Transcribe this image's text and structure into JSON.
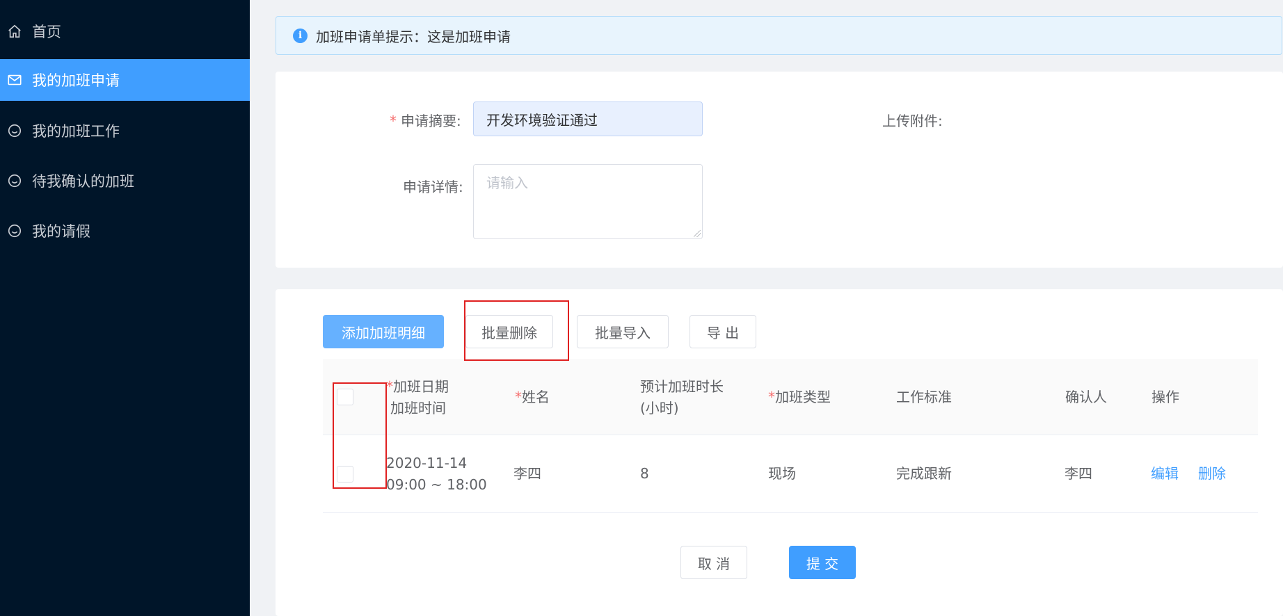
{
  "sidebar": {
    "items": [
      {
        "label": "首页",
        "icon": "home-icon",
        "active": false
      },
      {
        "label": "我的加班申请",
        "icon": "mail-icon",
        "active": true
      },
      {
        "label": "我的加班工作",
        "icon": "smile-icon",
        "active": false
      },
      {
        "label": "待我确认的加班",
        "icon": "smile-icon",
        "active": false
      },
      {
        "label": "我的请假",
        "icon": "smile-icon",
        "active": false
      }
    ]
  },
  "alert": {
    "icon": "info-icon",
    "icon_glyph": "i",
    "text": "加班申请单提示：这是加班申请"
  },
  "form": {
    "summary_required_mark": "*",
    "summary_label": "申请摘要:",
    "summary_value": "开发环境验证通过",
    "detail_label": "申请详情:",
    "detail_placeholder": "请输入",
    "attachment_label": "上传附件:"
  },
  "toolbar": {
    "add_label": "添加加班明细",
    "batch_delete_label": "批量删除",
    "batch_import_label": "批量导入",
    "export_label": "导 出"
  },
  "table": {
    "headers": {
      "date_required_mark": "*",
      "date_line1": "加班日期",
      "date_line2": "加班时间",
      "name_required_mark": "*",
      "name": "姓名",
      "hours_line1": "预计加班时长",
      "hours_line2": "(小时)",
      "type_required_mark": "*",
      "type": "加班类型",
      "standard": "工作标准",
      "confirmer": "确认人",
      "actions": "操作"
    },
    "rows": [
      {
        "date": "2020-11-14",
        "time": "09:00 ~ 18:00",
        "name": "李四",
        "hours": "8",
        "type": "现场",
        "standard": "完成跟新",
        "confirmer": "李四",
        "edit_label": "编辑",
        "delete_label": "删除"
      }
    ]
  },
  "footer": {
    "cancel_label": "取 消",
    "submit_label": "提 交"
  },
  "colors": {
    "sidebar_bg": "#001529",
    "active_item": "#409eff",
    "primary": "#409eff",
    "highlight_box": "#e02020",
    "required_mark": "#f56c6c"
  }
}
